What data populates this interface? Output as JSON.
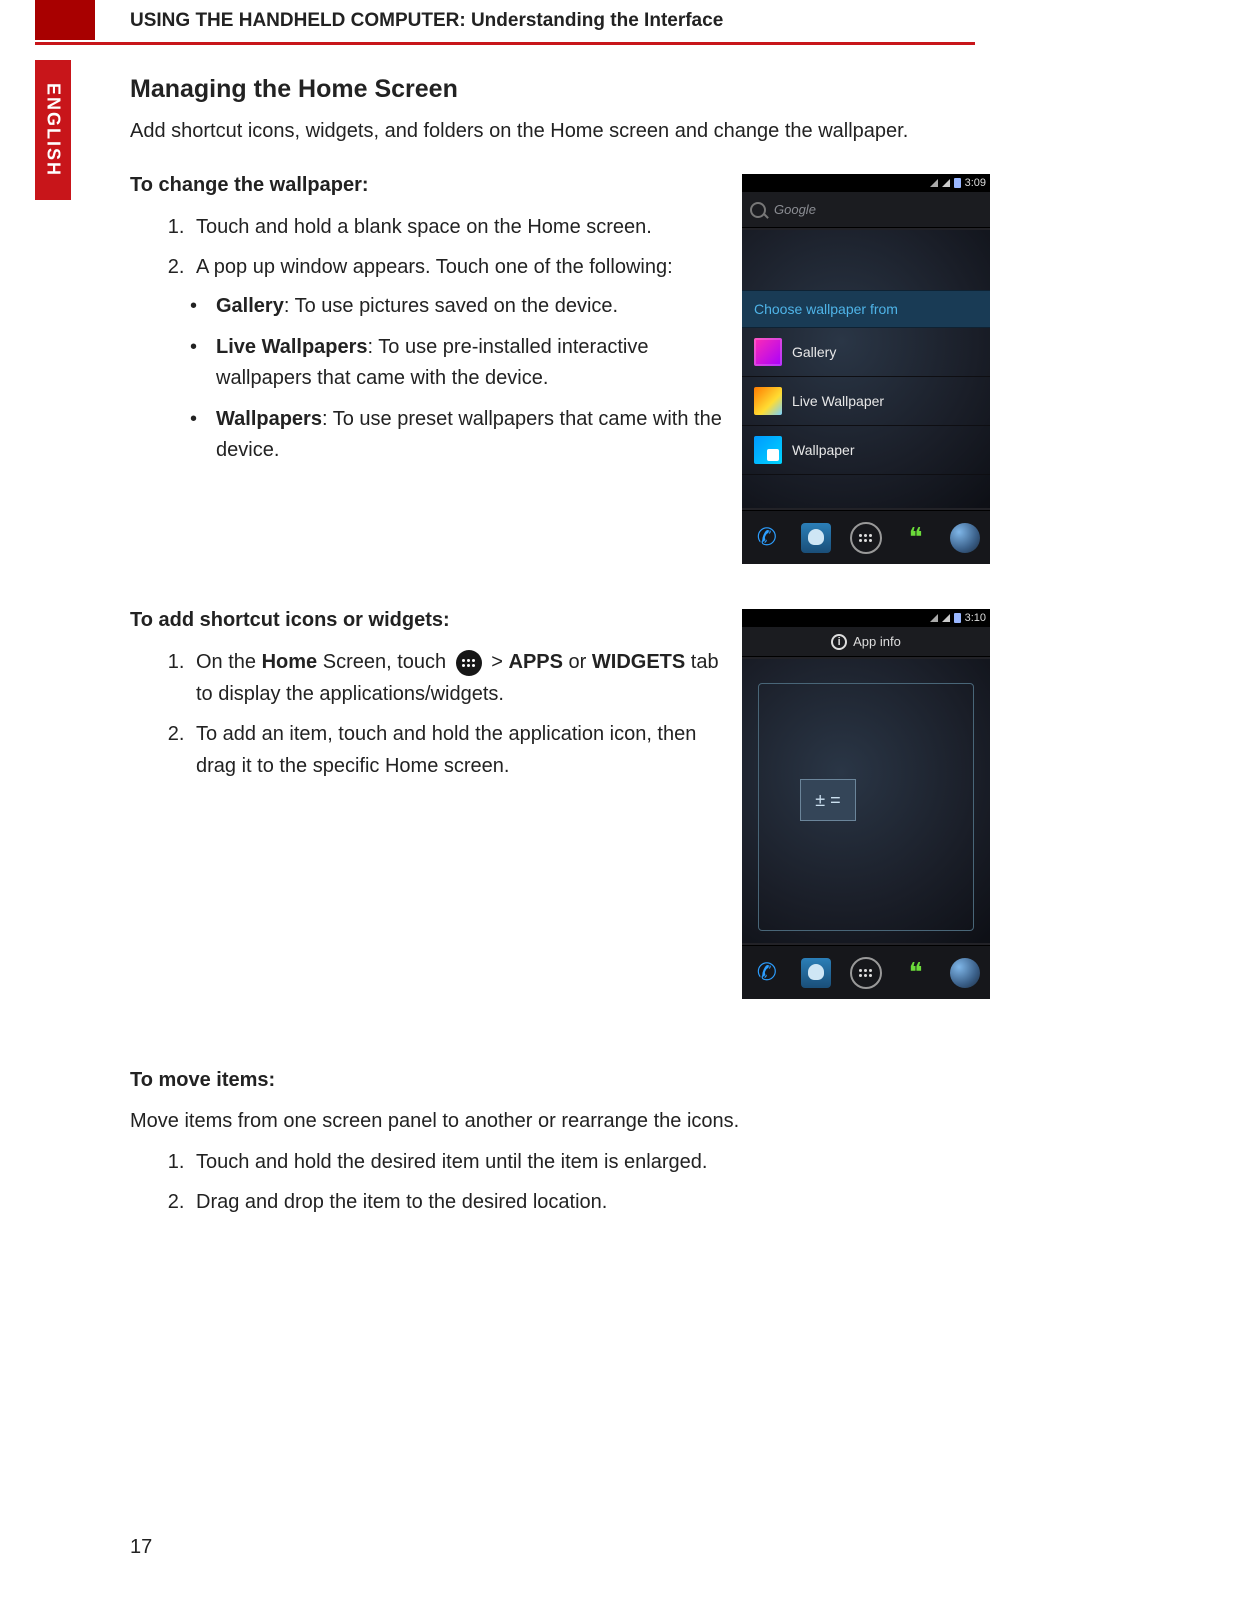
{
  "header": {
    "chapter": "USING THE HANDHELD COMPUTER: Understanding the Interface",
    "language_tab": "ENGLISH",
    "page_number": "17"
  },
  "section": {
    "title": "Managing the Home Screen",
    "intro": "Add shortcut icons, widgets, and folders on the Home screen and change the wallpaper."
  },
  "wallpaper": {
    "heading": "To change the wallpaper:",
    "step1": "Touch and hold a blank space on the Home screen.",
    "step2": "A pop up window appears. Touch one of the following:",
    "opt1_label": "Gallery",
    "opt1_desc": ": To use pictures saved on the device.",
    "opt2_label": "Live Wallpapers",
    "opt2_desc": ": To use pre-installed interactive wallpapers that came with the device.",
    "opt3_label": "Wallpapers",
    "opt3_desc": ": To use preset wallpapers that came with the device."
  },
  "shortcuts": {
    "heading": "To add shortcut icons or widgets:",
    "step1_a": "On the ",
    "step1_home": "Home",
    "step1_b": " Screen, touch ",
    "step1_c": " > ",
    "step1_apps": "APPS",
    "step1_d": " or ",
    "step1_widgets": "WIDGETS",
    "step1_e": " tab to display the applications/widgets.",
    "step2": "To add an item, touch and hold the application icon, then drag it to the specific Home screen."
  },
  "move": {
    "heading": "To move items:",
    "desc": "Move items from one screen panel to another or rearrange the icons.",
    "step1": "Touch and hold the desired item until the item is enlarged.",
    "step2": "Drag and drop the item to the desired location."
  },
  "screenshot1": {
    "time": "3:09",
    "search_label": "Google",
    "dialog_title": "Choose wallpaper from",
    "item1": "Gallery",
    "item2": "Live Wallpaper",
    "item3": "Wallpaper"
  },
  "screenshot2": {
    "time": "3:10",
    "top_label": "App info",
    "widget_glyph": "± ="
  }
}
